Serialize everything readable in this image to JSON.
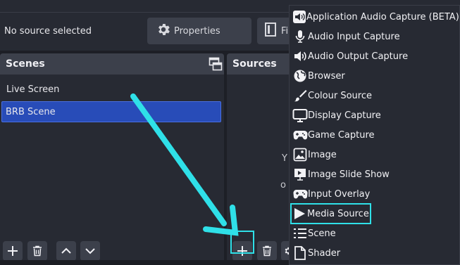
{
  "context_bar": {
    "no_source_text": "No source selected",
    "properties_label": "Properties",
    "filters_label": "Fi"
  },
  "scenes": {
    "title": "Scenes",
    "items": [
      {
        "label": "Live Screen",
        "selected": false
      },
      {
        "label": "BRB Scene",
        "selected": true
      }
    ]
  },
  "sources": {
    "title": "Sources",
    "partial_line1": "Y",
    "partial_line2": "o"
  },
  "menu": {
    "items": [
      {
        "label": "Application Audio Capture (BETA)",
        "icon": "speaker-icon"
      },
      {
        "label": "Audio Input Capture",
        "icon": "microphone-icon"
      },
      {
        "label": "Audio Output Capture",
        "icon": "speaker-icon"
      },
      {
        "label": "Browser",
        "icon": "globe-icon"
      },
      {
        "label": "Colour Source",
        "icon": "paintbrush-icon"
      },
      {
        "label": "Display Capture",
        "icon": "monitor-icon"
      },
      {
        "label": "Game Capture",
        "icon": "gamepad-icon"
      },
      {
        "label": "Image",
        "icon": "image-icon"
      },
      {
        "label": "Image Slide Show",
        "icon": "slideshow-icon"
      },
      {
        "label": "Input Overlay",
        "icon": "gamepad-icon"
      },
      {
        "label": "Media Source",
        "icon": "play-icon",
        "highlighted": true
      },
      {
        "label": "Scene",
        "icon": "list-icon"
      },
      {
        "label": "Shader",
        "icon": "file-icon"
      }
    ]
  },
  "colors": {
    "accent_highlight": "#2fe0e8",
    "selection_blue": "#284cb8",
    "panel_bg": "#272a33",
    "header_bg": "#3c404b"
  }
}
